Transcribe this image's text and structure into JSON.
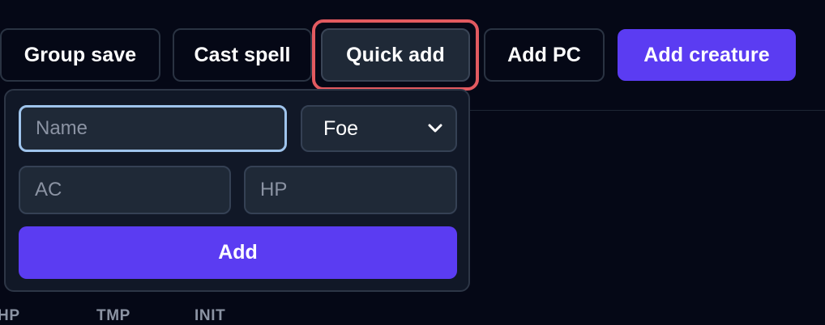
{
  "toolbar": {
    "group_save_label": "Group save",
    "cast_spell_label": "Cast spell",
    "quick_add_label": "Quick add",
    "add_pc_label": "Add PC",
    "add_creature_label": "Add creature"
  },
  "quick_add_form": {
    "name_placeholder": "Name",
    "faction_selected": "Foe",
    "ac_placeholder": "AC",
    "hp_placeholder": "HP",
    "submit_label": "Add"
  },
  "stats": {
    "hp_label": "HP",
    "tmp_label": "TMP",
    "init_label": "INIT"
  },
  "colors": {
    "background": "#050816",
    "accent": "#5b3cf2",
    "focus_ring": "#e25a60",
    "input_focus": "#9fc4ec",
    "panel": "#111827"
  },
  "icons": {
    "select_arrow": "chevron-down-icon"
  }
}
